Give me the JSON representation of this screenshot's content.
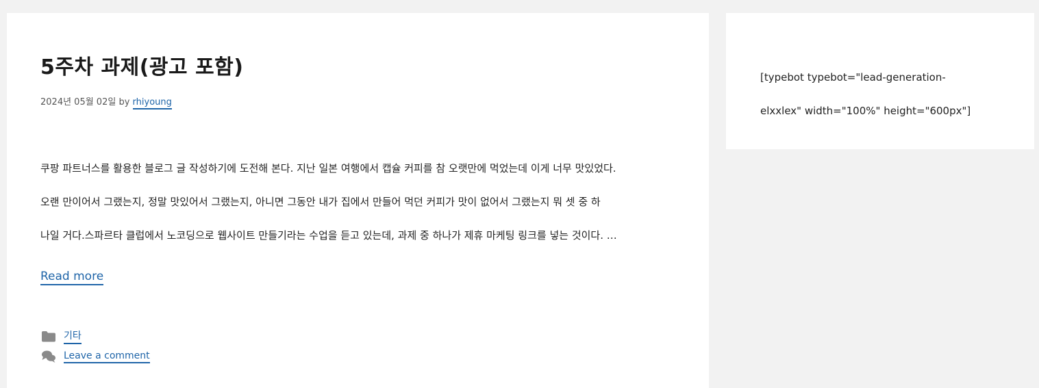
{
  "post": {
    "title": "5주차 과제(광고 포함)",
    "meta_date": "2024년 05월 02일 by",
    "meta_author": "rhiyoung",
    "excerpt_lines": [
      "쿠팡 파트너스를 활용한 블로그 글 작성하기에 도전해 본다. 지난 일본 여행에서 캡슐 커피를 참 오랫만에 먹었는데 이게 너무 맛있었다.",
      "오랜 만이어서 그랬는지, 정말 맛있어서 그랬는지, 아니면 그동안 내가 집에서 만들어 먹던 커피가 맛이 없어서 그랬는지 뭐 셋 중 하",
      "나일 거다.스파르타 클럽에서 노코딩으로 웹사이트 만들기라는 수업을 듣고 있는데, 과제 중 하나가 제휴 마케팅 링크를 넣는 것이다. …"
    ],
    "read_more": "Read more",
    "category": "기타",
    "comment_link": "Leave a comment",
    "icons": {
      "category": "folder-icon",
      "comment": "comments-icon"
    }
  },
  "sidebar": {
    "shortcode_lines": [
      "[typebot typebot=\"lead-generation-",
      "elxxlex\" width=\"100%\" height=\"600px\"]"
    ]
  },
  "colors": {
    "link": "#1e64a8",
    "page_background": "#f2f2f2",
    "card_background": "#ffffff",
    "icon": "#8a8a8a"
  }
}
